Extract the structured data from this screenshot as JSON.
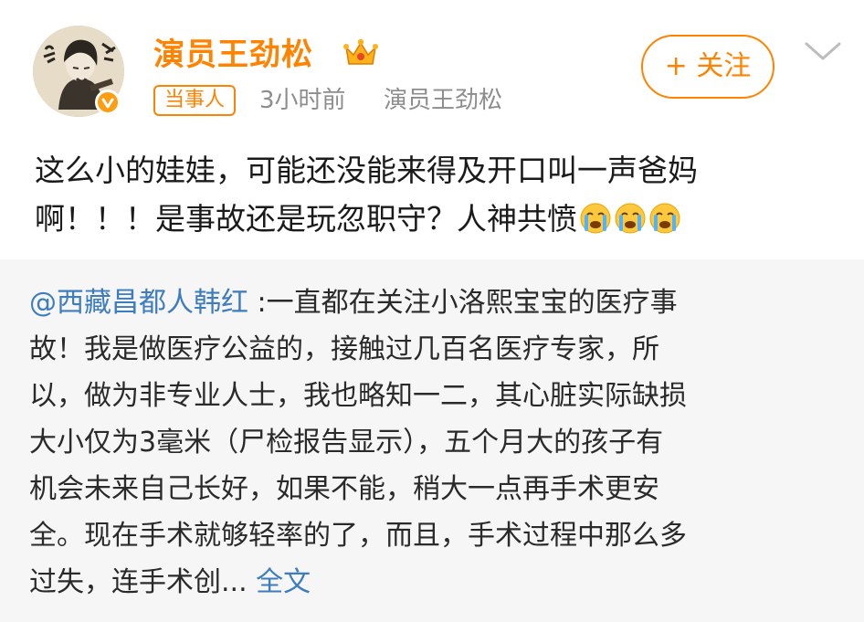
{
  "post": {
    "author": {
      "name": "演员王劲松",
      "avatar_icon": "avatar",
      "verified_icon": "verified-badge-icon",
      "crown_icon": "crown-icon",
      "badge_label": "当事人"
    },
    "meta": {
      "time": "3小时前",
      "source": "演员王劲松"
    },
    "follow_label": "+ 关注",
    "more_icon": "chevron-down-icon",
    "text_lines": [
      "这么小的娃娃，可能还没能来得及开口叫一声爸妈",
      "啊！！！是事故还是玩忽职守？人神共愤"
    ],
    "emojis": [
      "crying-emoji",
      "crying-emoji",
      "crying-emoji"
    ]
  },
  "quote": {
    "mention": "@西藏昌都人韩红",
    "lines": [
      " :一直都在关注小洛熙宝宝的医疗事",
      "故！我是做医疗公益的，接触过几百名医疗专家，所",
      "以，做为非专业人士，我也略知一二，其心脏实际缺损",
      "大小仅为3毫米（尸检报告显示），五个月大的孩子有",
      "机会未来自己长好，如果不能，稍大一点再手术更安",
      "全。现在手术就够轻率的了，而且，手术过程中那么多",
      "过失，连手术创..."
    ],
    "full_text_label": "全文"
  },
  "colors": {
    "accent": "#ff8200",
    "link": "#3c7cbf",
    "meta": "#8d8d8d",
    "quote_bg": "#f6f6f6"
  }
}
